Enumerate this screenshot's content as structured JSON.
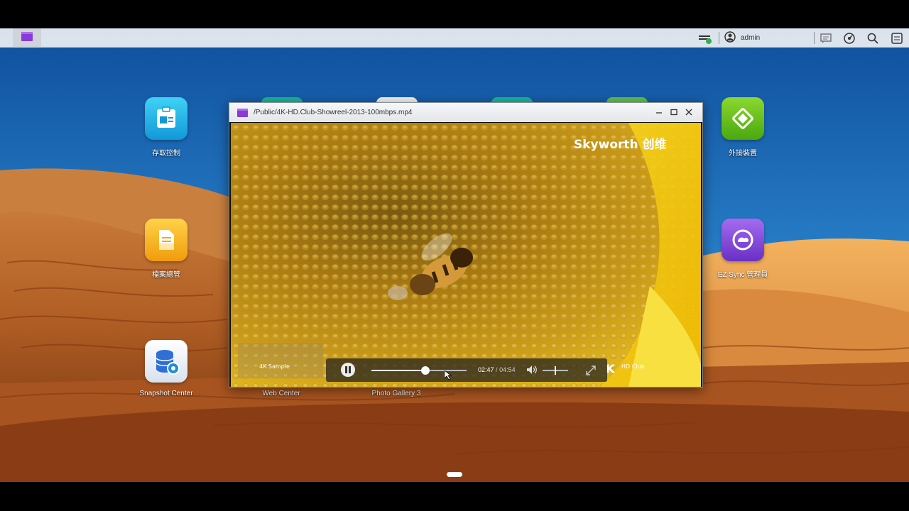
{
  "taskbar": {
    "active_app": "video-player",
    "user": "admin",
    "colors": {
      "active_app_icon": "#8a3ad6",
      "status_ok": "#2fb04c"
    }
  },
  "desktop": {
    "apps": [
      {
        "label": "存取控制",
        "icon": "access-control-icon",
        "color": "#18b9e8"
      },
      {
        "label": "外接裝置",
        "icon": "external-device-icon",
        "color": "#6cc21a"
      },
      {
        "label": "檔案總管",
        "icon": "file-explorer-icon",
        "color": "#f4b21a"
      },
      {
        "label": "EZ Sync 管理員",
        "icon": "ez-sync-icon",
        "color": "#8a48d8"
      },
      {
        "label": "Snapshot Center",
        "icon": "snapshot-center-icon",
        "color": "#e9eef5"
      },
      {
        "label": "Web Center",
        "icon": "web-center-icon"
      },
      {
        "label": "Photo Gallery 3",
        "icon": "photo-gallery-icon"
      }
    ]
  },
  "player": {
    "title": "/Public/4K-HD.Club-Showreel-2013-100mbps.mp4",
    "watermark": "Skyworth 创维",
    "current_time": "02:47",
    "separator": "/",
    "duration": "04:54",
    "progress": 0.568,
    "volume": 0.5,
    "overlay_left": "4K Sample",
    "overlay_right": "HD Club"
  }
}
